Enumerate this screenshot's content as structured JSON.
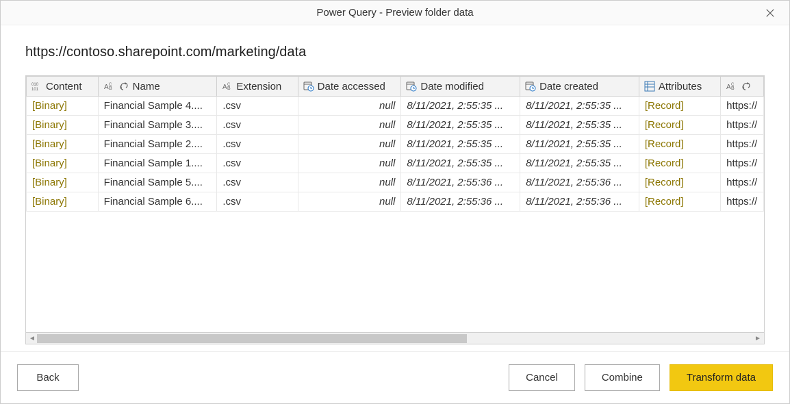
{
  "window": {
    "title": "Power Query - Preview folder data"
  },
  "content": {
    "path": "https://contoso.sharepoint.com/marketing/data"
  },
  "table": {
    "columns": [
      {
        "label": "Content",
        "type": "binary"
      },
      {
        "label": "Name",
        "type": "text-link"
      },
      {
        "label": "Extension",
        "type": "text"
      },
      {
        "label": "Date accessed",
        "type": "datetime"
      },
      {
        "label": "Date modified",
        "type": "datetime"
      },
      {
        "label": "Date created",
        "type": "datetime"
      },
      {
        "label": "Attributes",
        "type": "record"
      },
      {
        "label": "",
        "type": "text-link"
      }
    ],
    "rows": [
      {
        "content": "[Binary]",
        "name": "Financial Sample 4....",
        "ext": ".csv",
        "accessed": "null",
        "modified": "8/11/2021, 2:55:35 ...",
        "created": "8/11/2021, 2:55:35 ...",
        "attrs": "[Record]",
        "path": "https://"
      },
      {
        "content": "[Binary]",
        "name": "Financial Sample 3....",
        "ext": ".csv",
        "accessed": "null",
        "modified": "8/11/2021, 2:55:35 ...",
        "created": "8/11/2021, 2:55:35 ...",
        "attrs": "[Record]",
        "path": "https://"
      },
      {
        "content": "[Binary]",
        "name": "Financial Sample 2....",
        "ext": ".csv",
        "accessed": "null",
        "modified": "8/11/2021, 2:55:35 ...",
        "created": "8/11/2021, 2:55:35 ...",
        "attrs": "[Record]",
        "path": "https://"
      },
      {
        "content": "[Binary]",
        "name": "Financial Sample 1....",
        "ext": ".csv",
        "accessed": "null",
        "modified": "8/11/2021, 2:55:35 ...",
        "created": "8/11/2021, 2:55:35 ...",
        "attrs": "[Record]",
        "path": "https://"
      },
      {
        "content": "[Binary]",
        "name": "Financial Sample 5....",
        "ext": ".csv",
        "accessed": "null",
        "modified": "8/11/2021, 2:55:36 ...",
        "created": "8/11/2021, 2:55:36 ...",
        "attrs": "[Record]",
        "path": "https://"
      },
      {
        "content": "[Binary]",
        "name": "Financial Sample 6....",
        "ext": ".csv",
        "accessed": "null",
        "modified": "8/11/2021, 2:55:36 ...",
        "created": "8/11/2021, 2:55:36 ...",
        "attrs": "[Record]",
        "path": "https://"
      }
    ]
  },
  "footer": {
    "back": "Back",
    "cancel": "Cancel",
    "combine": "Combine",
    "transform": "Transform data"
  }
}
